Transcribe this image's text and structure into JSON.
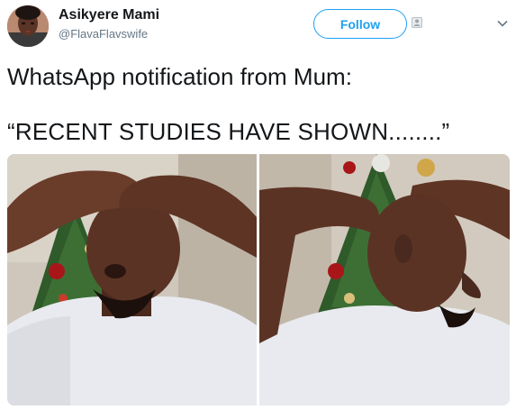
{
  "author": {
    "name": "Asikyere Mami",
    "handle": "@FlavaFlavswife",
    "avatar_icon": "user-avatar"
  },
  "header": {
    "follow_label": "Follow",
    "follow_icon": "person-add-icon",
    "more_icon": "chevron-down-icon"
  },
  "tweet": {
    "line_1": "WhatsApp notification from Mum:",
    "line_2": "“RECENT STUDIES HAVE SHOWN........”"
  },
  "media": {
    "images": [
      {
        "name": "media-image-left"
      },
      {
        "name": "media-image-right"
      }
    ]
  },
  "colors": {
    "accent": "#1da1f2",
    "text": "#14171a",
    "secondary_text": "#657786"
  }
}
